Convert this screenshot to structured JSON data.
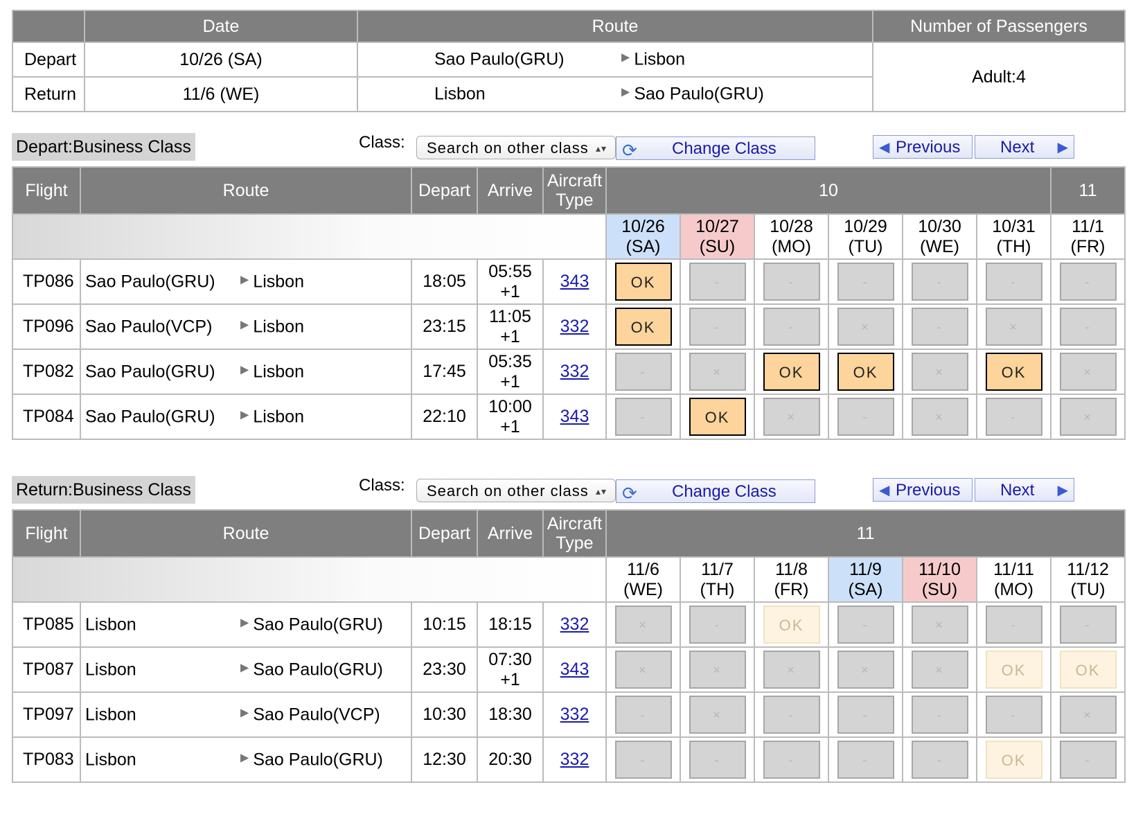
{
  "summary": {
    "headers": [
      "",
      "Date",
      "Route",
      "Number of Passengers"
    ],
    "rows": [
      {
        "label": "Depart",
        "date": "10/26 (SA)",
        "from": "Sao Paulo(GRU)",
        "to": "Lisbon"
      },
      {
        "label": "Return",
        "date": "11/6 (WE)",
        "from": "Lisbon",
        "to": "Sao Paulo(GRU)"
      }
    ],
    "passengers": "Adult:4"
  },
  "controls": {
    "class_label": "Class:",
    "select_value": "Search on other class",
    "change_class": "Change Class",
    "previous": "Previous",
    "next": "Next"
  },
  "depart": {
    "title": "Depart:Business Class",
    "headers": {
      "flight": "Flight",
      "route": "Route",
      "depart": "Depart",
      "arrive": "Arrive",
      "aircraft": "Aircraft Type"
    },
    "months": [
      {
        "label": "10",
        "span": 6
      },
      {
        "label": "11",
        "span": 1
      }
    ],
    "dates": [
      {
        "d": "10/26",
        "w": "(SA)",
        "type": "sa"
      },
      {
        "d": "10/27",
        "w": "(SU)",
        "type": "su"
      },
      {
        "d": "10/28",
        "w": "(MO)",
        "type": ""
      },
      {
        "d": "10/29",
        "w": "(TU)",
        "type": ""
      },
      {
        "d": "10/30",
        "w": "(WE)",
        "type": ""
      },
      {
        "d": "10/31",
        "w": "(TH)",
        "type": ""
      },
      {
        "d": "11/1",
        "w": "(FR)",
        "type": ""
      }
    ],
    "flights": [
      {
        "flight": "TP086",
        "from": "Sao Paulo(GRU)",
        "to": "Lisbon",
        "dep": "18:05",
        "arr": "05:55",
        "arr2": "+1",
        "ac": "343",
        "cells": [
          "ok",
          "dash",
          "dash",
          "dash",
          "dash",
          "dash",
          "dash"
        ]
      },
      {
        "flight": "TP096",
        "from": "Sao Paulo(VCP)",
        "to": "Lisbon",
        "dep": "23:15",
        "arr": "11:05",
        "arr2": "+1",
        "ac": "332",
        "cells": [
          "ok",
          "dash",
          "dash",
          "x",
          "dash",
          "x",
          "dash"
        ]
      },
      {
        "flight": "TP082",
        "from": "Sao Paulo(GRU)",
        "to": "Lisbon",
        "dep": "17:45",
        "arr": "05:35",
        "arr2": "+1",
        "ac": "332",
        "cells": [
          "dash",
          "x",
          "ok",
          "ok",
          "x",
          "ok",
          "x"
        ]
      },
      {
        "flight": "TP084",
        "from": "Sao Paulo(GRU)",
        "to": "Lisbon",
        "dep": "22:10",
        "arr": "10:00",
        "arr2": "+1",
        "ac": "343",
        "cells": [
          "dash",
          "ok",
          "x",
          "dash",
          "x",
          "dash",
          "x"
        ]
      }
    ]
  },
  "return": {
    "title": "Return:Business Class",
    "headers": {
      "flight": "Flight",
      "route": "Route",
      "depart": "Depart",
      "arrive": "Arrive",
      "aircraft": "Aircraft Type"
    },
    "months": [
      {
        "label": "11",
        "span": 7
      }
    ],
    "dates": [
      {
        "d": "11/6",
        "w": "(WE)",
        "type": ""
      },
      {
        "d": "11/7",
        "w": "(TH)",
        "type": ""
      },
      {
        "d": "11/8",
        "w": "(FR)",
        "type": ""
      },
      {
        "d": "11/9",
        "w": "(SA)",
        "type": "sa"
      },
      {
        "d": "11/10",
        "w": "(SU)",
        "type": "su"
      },
      {
        "d": "11/11",
        "w": "(MO)",
        "type": ""
      },
      {
        "d": "11/12",
        "w": "(TU)",
        "type": ""
      }
    ],
    "flights": [
      {
        "flight": "TP085",
        "from": "Lisbon",
        "to": "Sao Paulo(GRU)",
        "dep": "10:15",
        "arr": "18:15",
        "arr2": "",
        "ac": "332",
        "cells": [
          "x",
          "dash",
          "okl",
          "dash",
          "x",
          "dash",
          "dash"
        ]
      },
      {
        "flight": "TP087",
        "from": "Lisbon",
        "to": "Sao Paulo(GRU)",
        "dep": "23:30",
        "arr": "07:30",
        "arr2": "+1",
        "ac": "343",
        "cells": [
          "x",
          "x",
          "x",
          "x",
          "x",
          "okl",
          "okl"
        ]
      },
      {
        "flight": "TP097",
        "from": "Lisbon",
        "to": "Sao Paulo(VCP)",
        "dep": "10:30",
        "arr": "18:30",
        "arr2": "",
        "ac": "332",
        "cells": [
          "dash",
          "x",
          "dash",
          "dash",
          "dash",
          "dash",
          "x"
        ]
      },
      {
        "flight": "TP083",
        "from": "Lisbon",
        "to": "Sao Paulo(GRU)",
        "dep": "12:30",
        "arr": "20:30",
        "arr2": "",
        "ac": "332",
        "cells": [
          "dash",
          "dash",
          "dash",
          "dash",
          "dash",
          "okl",
          "dash"
        ]
      }
    ]
  },
  "cell_text": {
    "ok": "OK",
    "okl": "OK",
    "dash": "-",
    "x": "×"
  },
  "colors": {
    "header_bg": "#7f7f7f",
    "ok_bg": "#fdd49b",
    "ok_light_bg": "#fdf3e0",
    "unavail_bg": "#d4d4d4",
    "saturday": "#cde0fa",
    "sunday": "#f6cacb",
    "link": "#1a1ab0"
  }
}
